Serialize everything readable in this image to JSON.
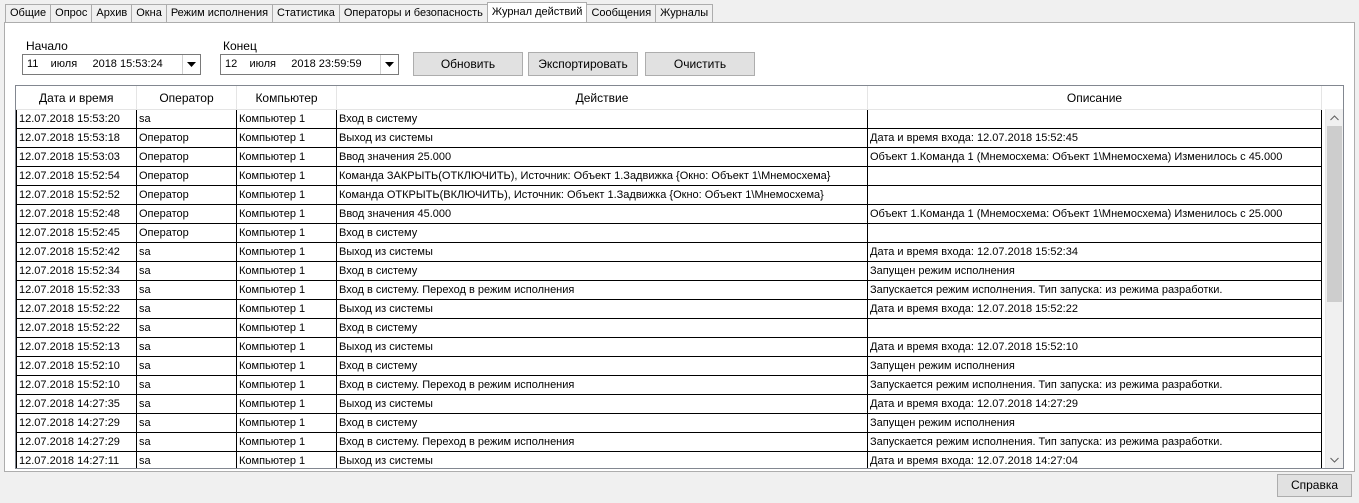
{
  "tabs": [
    {
      "label": "Общие",
      "active": false
    },
    {
      "label": "Опрос",
      "active": false
    },
    {
      "label": "Архив",
      "active": false
    },
    {
      "label": "Окна",
      "active": false
    },
    {
      "label": "Режим исполнения",
      "active": false
    },
    {
      "label": "Статистика",
      "active": false
    },
    {
      "label": "Операторы и безопасность",
      "active": false
    },
    {
      "label": "Журнал действий",
      "active": true
    },
    {
      "label": "Сообщения",
      "active": false
    },
    {
      "label": "Журналы",
      "active": false
    }
  ],
  "filters": {
    "start_label": "Начало",
    "start_value": "11    июля     2018 15:53:24",
    "end_label": "Конец",
    "end_value": "12    июля     2018 23:59:59"
  },
  "buttons": {
    "refresh": "Обновить",
    "export": "Экспортировать",
    "clear": "Очистить",
    "help": "Справка"
  },
  "table": {
    "columns": [
      "Дата и время",
      "Оператор",
      "Компьютер",
      "Действие",
      "Описание"
    ],
    "rows": [
      [
        "12.07.2018 15:53:20",
        "sa",
        "Компьютер 1",
        "Вход в систему",
        ""
      ],
      [
        "12.07.2018 15:53:18",
        "Оператор",
        "Компьютер 1",
        "Выход из системы",
        "Дата и время входа: 12.07.2018 15:52:45"
      ],
      [
        "12.07.2018 15:53:03",
        "Оператор",
        "Компьютер 1",
        "Ввод значения 25.000",
        "Объект 1.Команда 1 (Мнемосхема: Объект 1\\Мнемосхема) Изменилось с  45.000"
      ],
      [
        "12.07.2018 15:52:54",
        "Оператор",
        "Компьютер 1",
        "Команда ЗАКРЫТЬ(ОТКЛЮЧИТЬ), Источник: Объект 1.Задвижка {Окно: Объект 1\\Мнемосхема}",
        ""
      ],
      [
        "12.07.2018 15:52:52",
        "Оператор",
        "Компьютер 1",
        "Команда ОТКРЫТЬ(ВКЛЮЧИТЬ), Источник: Объект 1.Задвижка {Окно: Объект 1\\Мнемосхема}",
        ""
      ],
      [
        "12.07.2018 15:52:48",
        "Оператор",
        "Компьютер 1",
        "Ввод значения 45.000",
        "Объект 1.Команда 1 (Мнемосхема: Объект 1\\Мнемосхема) Изменилось с  25.000"
      ],
      [
        "12.07.2018 15:52:45",
        "Оператор",
        "Компьютер 1",
        "Вход в систему",
        ""
      ],
      [
        "12.07.2018 15:52:42",
        "sa",
        "Компьютер 1",
        "Выход из системы",
        "Дата и время входа: 12.07.2018 15:52:34"
      ],
      [
        "12.07.2018 15:52:34",
        "sa",
        "Компьютер 1",
        "Вход в систему",
        "Запущен режим исполнения"
      ],
      [
        "12.07.2018 15:52:33",
        "sa",
        "Компьютер 1",
        "Вход в систему. Переход в режим исполнения",
        "Запускается режим исполнения. Тип запуска: из режима разработки."
      ],
      [
        "12.07.2018 15:52:22",
        "sa",
        "Компьютер 1",
        "Выход из системы",
        "Дата и время входа: 12.07.2018 15:52:22"
      ],
      [
        "12.07.2018 15:52:22",
        "sa",
        "Компьютер 1",
        "Вход в систему",
        ""
      ],
      [
        "12.07.2018 15:52:13",
        "sa",
        "Компьютер 1",
        "Выход из системы",
        "Дата и время входа: 12.07.2018 15:52:10"
      ],
      [
        "12.07.2018 15:52:10",
        "sa",
        "Компьютер 1",
        "Вход в систему",
        "Запущен режим исполнения"
      ],
      [
        "12.07.2018 15:52:10",
        "sa",
        "Компьютер 1",
        "Вход в систему. Переход в режим исполнения",
        "Запускается режим исполнения. Тип запуска: из режима разработки."
      ],
      [
        "12.07.2018 14:27:35",
        "sa",
        "Компьютер 1",
        "Выход из системы",
        "Дата и время входа: 12.07.2018 14:27:29"
      ],
      [
        "12.07.2018 14:27:29",
        "sa",
        "Компьютер 1",
        "Вход в систему",
        "Запущен режим исполнения"
      ],
      [
        "12.07.2018 14:27:29",
        "sa",
        "Компьютер 1",
        "Вход в систему. Переход в режим исполнения",
        "Запускается режим исполнения. Тип запуска: из режима разработки."
      ],
      [
        "12.07.2018 14:27:11",
        "sa",
        "Компьютер 1",
        "Выход из системы",
        "Дата и время входа: 12.07.2018 14:27:04"
      ]
    ]
  },
  "scrollbar": {
    "position": 0.0,
    "visible_fraction": 0.54
  },
  "icons": {
    "dropdown": "chevron-down-icon",
    "scroll_up": "scroll-up-arrow-icon",
    "scroll_down": "scroll-down-arrow-icon"
  },
  "colors": {
    "window_bg": "#f0f0f0",
    "button_bg": "#e1e1e1",
    "border": "#adadad",
    "scroll_thumb": "#cdcdcd"
  }
}
